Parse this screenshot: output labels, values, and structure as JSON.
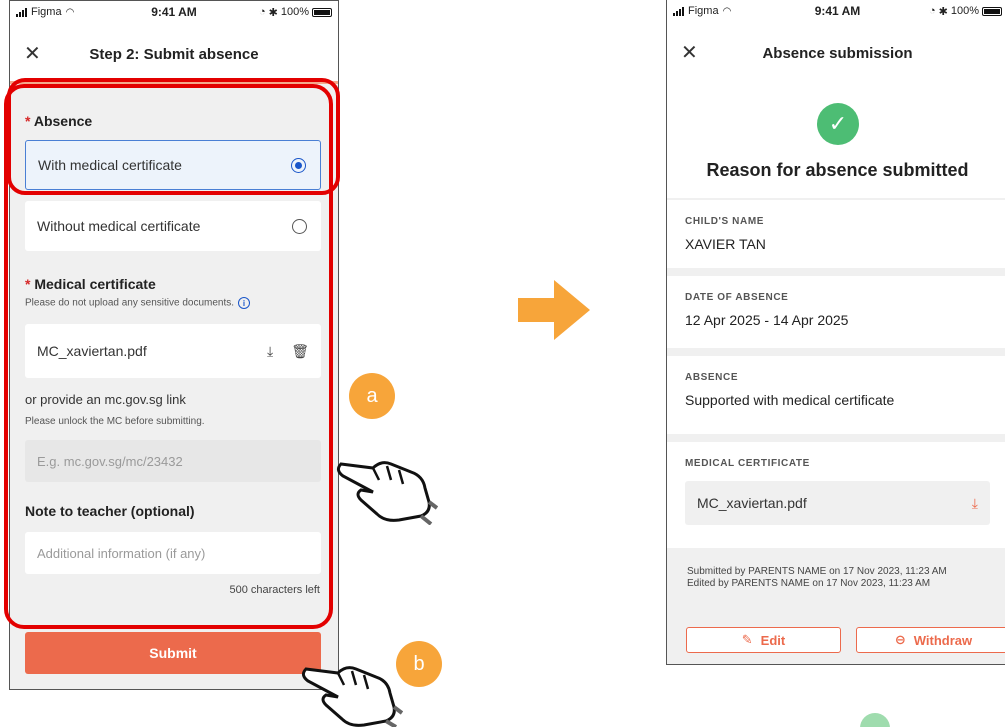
{
  "status_bar": {
    "carrier": "Figma",
    "time": "9:41 AM",
    "battery": "100%"
  },
  "left_screen": {
    "title": "Step 2: Submit absence",
    "absence_label": "Absence",
    "required_mark": "*",
    "options": [
      {
        "label": "With medical certificate",
        "selected": true
      },
      {
        "label": "Without medical certificate",
        "selected": false
      }
    ],
    "mc_label": "Medical certificate",
    "mc_hint": "Please do not upload any sensitive documents.",
    "file_name": "MC_xaviertan.pdf",
    "link_label": "or provide an mc.gov.sg link",
    "link_hint": "Please unlock the MC before submitting.",
    "link_placeholder": "E.g. mc.gov.sg/mc/23432",
    "note_label": "Note to teacher (optional)",
    "note_placeholder": "Additional information (if any)",
    "char_count": "500 characters left",
    "submit_label": "Submit"
  },
  "right_screen": {
    "title": "Absence submission",
    "success_message": "Reason for absence submitted",
    "child_name_label": "CHILD'S NAME",
    "child_name": "XAVIER TAN",
    "date_label": "DATE OF ABSENCE",
    "date_value": "12 Apr 2025 - 14 Apr 2025",
    "absence_label": "ABSENCE",
    "absence_value": "Supported with medical certificate",
    "mc_label": "MEDICAL CERTIFICATE",
    "mc_file": "MC_xaviertan.pdf",
    "submitted_by": "Submitted by PARENTS NAME on 17 Nov 2023, 11:23 AM",
    "edited_by": "Edited by PARENTS NAME on 17 Nov 2023, 11:23 AM",
    "edit_label": "Edit",
    "withdraw_label": "Withdraw"
  },
  "annotations": {
    "badge_a": "a",
    "badge_b": "b"
  },
  "colors": {
    "accent": "#ec6a4c",
    "highlight": "#e30000",
    "success": "#4dbd74",
    "badge": "#f7a53a",
    "select_blue": "#1a56c9"
  },
  "icons": [
    "close-icon",
    "radio-icon",
    "info-icon",
    "download-icon",
    "trash-icon",
    "check-icon",
    "pencil-icon",
    "minus-circle-icon",
    "hand-pointer-icon",
    "arrow-right-icon"
  ]
}
